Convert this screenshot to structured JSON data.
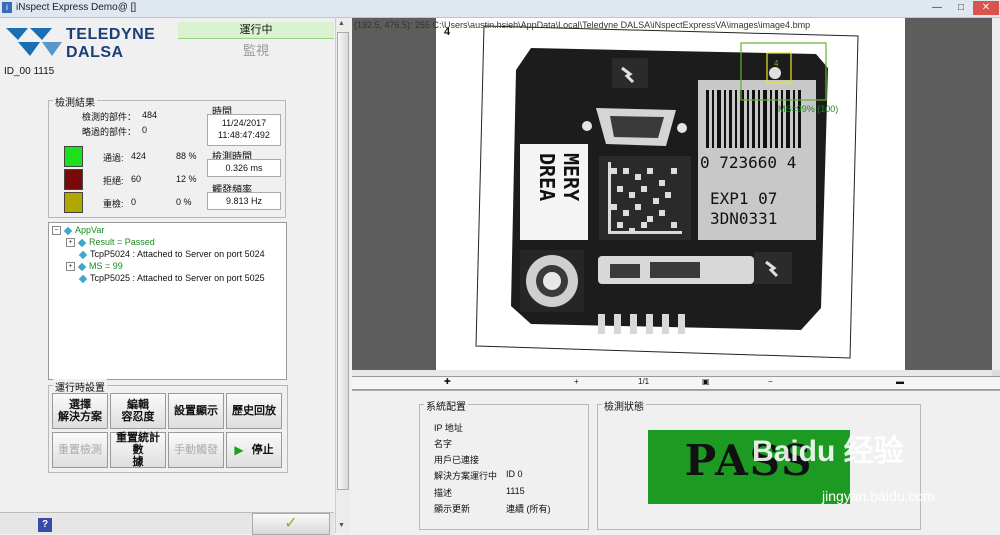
{
  "window": {
    "title": "iNspect Express Demo@ []",
    "min_label": "—",
    "max_label": "□",
    "close_label": "✕"
  },
  "header": {
    "logo_top": "TELEDYNE",
    "logo_bottom": "DALSA",
    "status": "運行中",
    "mode": "監視",
    "device_id": "ID_00  1115"
  },
  "results": {
    "title": "檢測結果",
    "inspected_label": "檢測的部件：",
    "inspected_value": "484",
    "skipped_label": "略過的部件：",
    "skipped_value": "0",
    "rows": [
      {
        "label": "通過:",
        "count": "424",
        "pct": "88 %",
        "color": "#1be01b"
      },
      {
        "label": "拒絕:",
        "count": "60",
        "pct": "12 %",
        "color": "#7a0a0a"
      },
      {
        "label": "重檢:",
        "count": "0",
        "pct": "0 %",
        "color": "#b2a600"
      }
    ],
    "time_title": "時間",
    "date": "11/24/2017",
    "time": "11:48:47:492",
    "insp_time_title": "檢測時間",
    "insp_time": "0.326 ms",
    "trigger_title": "觸發頻率",
    "trigger": "9.813 Hz"
  },
  "tree": {
    "root": "AppVar",
    "items": [
      {
        "text": "Result = Passed",
        "color": "#1a8c1a",
        "expand": "+"
      },
      {
        "text": "TcpP5024 : Attached to Server on port 5024",
        "color": "#222",
        "expand": ""
      },
      {
        "text": "MS = 99",
        "color": "#1a8c1a",
        "expand": "+"
      },
      {
        "text": "TcpP5025 : Attached to Server on port 5025",
        "color": "#222",
        "expand": ""
      }
    ]
  },
  "runtime": {
    "title": "運行時設置",
    "buttons": [
      {
        "label": "選擇\n解決方案",
        "enabled": true
      },
      {
        "label": "編輯\n容忍度",
        "enabled": true
      },
      {
        "label": "設置顯示",
        "enabled": true
      },
      {
        "label": "歷史回放",
        "enabled": true
      },
      {
        "label": "重置檢測",
        "enabled": false
      },
      {
        "label": "重置統計數\n據",
        "enabled": true
      },
      {
        "label": "手動觸發",
        "enabled": false
      },
      {
        "label": "停止",
        "enabled": true
      }
    ]
  },
  "bottom_bar": {
    "help_label": "?",
    "check_label": "✓"
  },
  "image": {
    "coord_text": "(192.5, 476.5): 255    C:\\Users\\austin.hsieh\\AppData\\Local\\Teledyne DALSA\\iNspectExpressVA\\images\\image4.bmp",
    "image_index": "4",
    "roi_label": "MS=99% (100)",
    "roi_marker": "4",
    "label_dream_1": "DREA",
    "label_dream_2": "MERY",
    "barcode_number": "0  723660  4",
    "barcode_line1": "EXP1  07",
    "barcode_line2": "3DN0331"
  },
  "ruler": {
    "marks": [
      "✚",
      "+",
      "1/1",
      "▣",
      "−",
      "▬"
    ]
  },
  "system": {
    "title": "系統配置",
    "rows": [
      {
        "label": "IP 地址",
        "value": ""
      },
      {
        "label": "名字",
        "value": ""
      },
      {
        "label": "用戶已連接",
        "value": ""
      },
      {
        "label": "解決方案運行中",
        "value": "ID 0"
      },
      {
        "label": "描述",
        "value": "1115"
      },
      {
        "label": "顯示更新",
        "value": "連續 (所有)"
      }
    ]
  },
  "inspection_status": {
    "title": "檢測狀態",
    "result": "PASS",
    "watermark": "Baidu 经验",
    "watermark_url": "jingyan.baidu.com"
  }
}
